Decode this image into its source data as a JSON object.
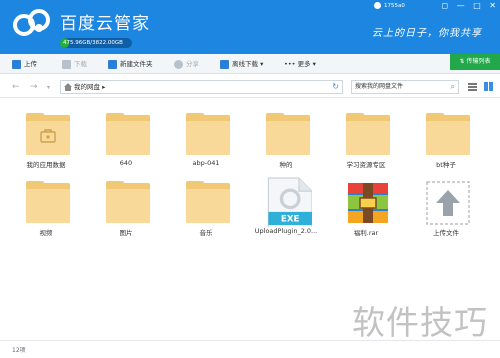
{
  "header": {
    "app_title": "百度云管家",
    "quota_text": "475.96GB/3822.00GB",
    "quota_fraction": 0.125,
    "user_name": "1755a0",
    "slogan": "云上的日子，你我共享",
    "window_buttons": [
      "◻",
      "—",
      "□",
      "✕"
    ]
  },
  "toolbar": {
    "upload": "上传",
    "download": "下载",
    "new_folder": "新建文件夹",
    "share": "分享",
    "offline_download": "离线下载",
    "more": "更多",
    "transfer_list": "传输列表"
  },
  "address": {
    "crumb": "我的网盘",
    "search_placeholder": "搜索我的网盘文件"
  },
  "files": [
    {
      "name": "我的应用数据",
      "type": "app-folder"
    },
    {
      "name": "640",
      "type": "folder"
    },
    {
      "name": "abp-041",
      "type": "folder"
    },
    {
      "name": "种的",
      "type": "folder"
    },
    {
      "name": "学习资源专区",
      "type": "folder"
    },
    {
      "name": "bt种子",
      "type": "folder"
    },
    {
      "name": "视频",
      "type": "folder"
    },
    {
      "name": "图片",
      "type": "folder"
    },
    {
      "name": "音乐",
      "type": "folder"
    },
    {
      "name": "UploadPlugin_2.0...",
      "type": "exe",
      "badge": "EXE"
    },
    {
      "name": "福利.rar",
      "type": "rar"
    },
    {
      "name": "上传文件",
      "type": "upload"
    }
  ],
  "status": {
    "count": "12项"
  },
  "watermark": "软件技巧",
  "colors": {
    "header_blue": "#1d86e0",
    "quota_green": "#27ae3c",
    "folder_yellow": "#f0c876",
    "transfer_green": "#22a74a"
  }
}
